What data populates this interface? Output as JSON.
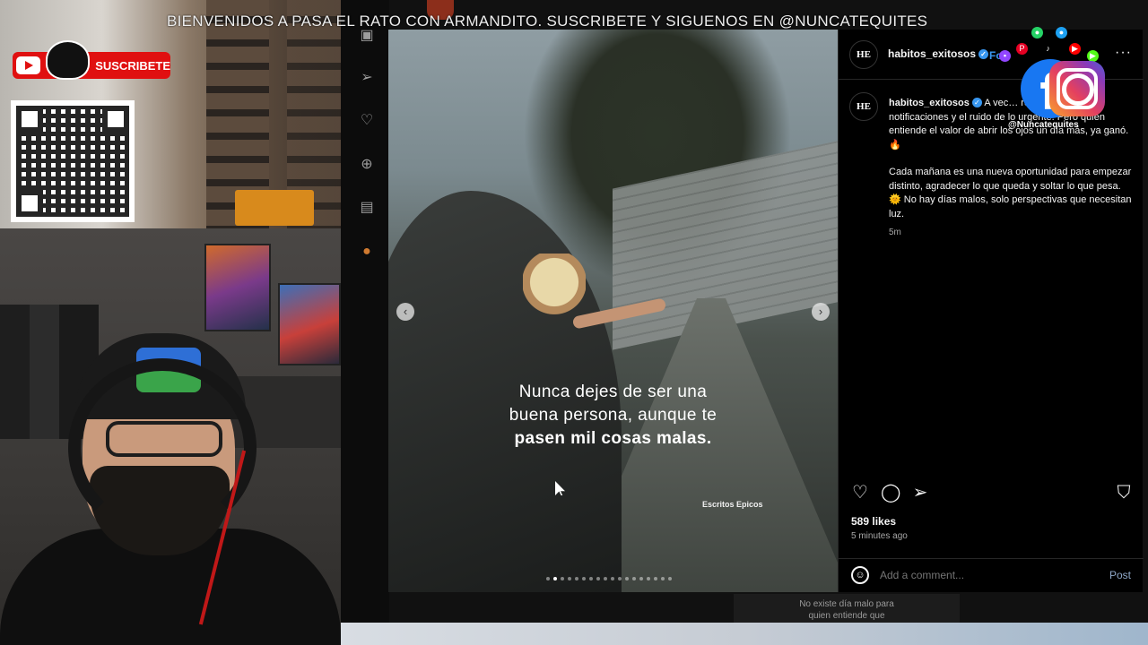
{
  "overlay": {
    "ticker_text": "BIENVENIDOS A PASA EL RATO CON ARMANDITO. SUSCRIBETE Y SIGUENOS EN @NUNCATEQUITES",
    "subscribe_label": "SUSCRIBETE",
    "social_handle": "@Nuncatequites",
    "bottom_caption_line1": "No existe día malo para",
    "bottom_caption_line2": "quien entiende que"
  },
  "sidebar_rail": {
    "icons": [
      "video-icon",
      "send-icon",
      "heart-icon",
      "create-icon",
      "analytics-icon",
      "profile-icon"
    ]
  },
  "post": {
    "image_caption_line1": "Nunca dejes de ser una",
    "image_caption_line2": "buena persona, aunque te",
    "image_caption_line3": "pasen mil cosas malas.",
    "image_watermark": "Escritos Epicos",
    "prev_glyph": "‹",
    "next_glyph": "›",
    "carousel_count": 18,
    "carousel_active_index": 1
  },
  "panel": {
    "avatar_text": "HE",
    "username": "habitos_exitosos",
    "verified_glyph": "✓",
    "follow_label": "Fo",
    "more_label": "···",
    "caption_part1": "A vec",
    "caption_part1_rest": "re pendientes, notificaciones y el ruido de lo urgente. Pero quien entiende el valor de abrir los ojos un día más, ya ganó. 🔥",
    "caption_para2": "Cada mañana es una nueva oportunidad para empezar distinto, agradecer lo que queda y soltar lo que pesa. 🌞 No hay días malos, solo perspectivas que necesitan luz.",
    "caption_time": "5m",
    "likes": "589 likes",
    "posted_ago": "5 minutes ago",
    "comment_placeholder": "Add a comment...",
    "post_button": "Post"
  },
  "colors": {
    "accent_blue": "#3897f0",
    "youtube_red": "#e01010",
    "facebook_blue": "#1877f2"
  }
}
